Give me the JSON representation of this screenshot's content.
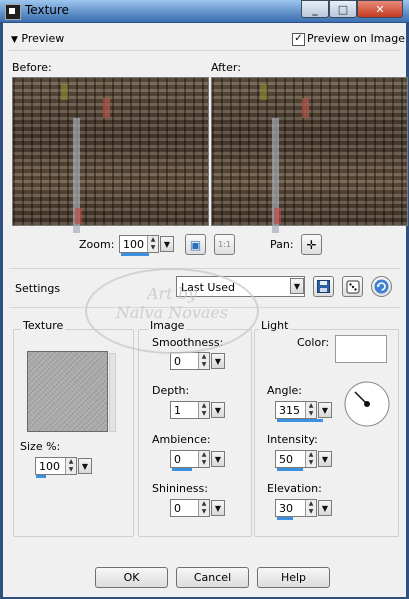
{
  "window": {
    "title": "Texture",
    "min": "_",
    "max": "□",
    "close": "✕"
  },
  "preview": {
    "toggle_label": "Preview",
    "preview_on_image_label": "Preview on Image",
    "preview_on_image_checked": true,
    "before_label": "Before:",
    "after_label": "After:",
    "zoom_label": "Zoom:",
    "zoom_value": "100",
    "fit_button": "▣",
    "actual_size_button": "1:1",
    "pan_label": "Pan:",
    "pan_button": "✛"
  },
  "settings": {
    "label": "Settings",
    "preset_value": "Last Used"
  },
  "texture": {
    "group_label": "Texture",
    "size_label": "Size %:",
    "size_value": "100",
    "size_fraction": 0.25
  },
  "image": {
    "group_label": "Image",
    "smoothness_label": "Smoothness:",
    "smoothness_value": "0",
    "depth_label": "Depth:",
    "depth_value": "1",
    "ambience_label": "Ambience:",
    "ambience_value": "0",
    "shininess_label": "Shininess:",
    "shininess_value": "0"
  },
  "light": {
    "group_label": "Light",
    "color_label": "Color:",
    "color_value": "#ffffff",
    "angle_label": "Angle:",
    "angle_value": "315",
    "intensity_label": "Intensity:",
    "intensity_value": "50",
    "elevation_label": "Elevation:",
    "elevation_value": "30"
  },
  "watermark": {
    "line1": "Art by",
    "line2": "Nalva Novaes"
  },
  "buttons": {
    "ok": "OK",
    "cancel": "Cancel",
    "help": "Help"
  }
}
